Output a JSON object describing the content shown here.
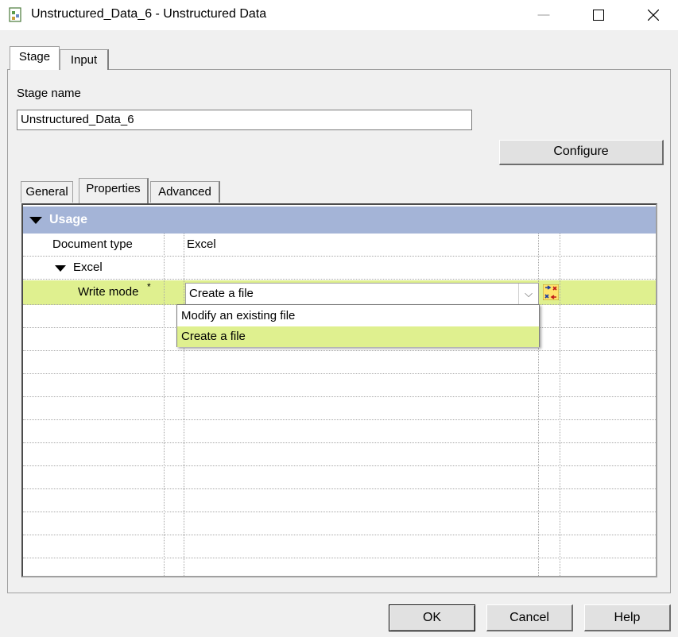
{
  "window": {
    "title": "Unstructured_Data_6 - Unstructured Data",
    "minimize_glyph": "—",
    "maximize_glyph": "☐",
    "close_glyph": "✕"
  },
  "outer_tabs": [
    {
      "label": "Stage",
      "active": true
    },
    {
      "label": "Input",
      "active": false
    }
  ],
  "stage_name": {
    "label": "Stage name",
    "value": "Unstructured_Data_6"
  },
  "configure_button": "Configure",
  "inner_tabs": [
    {
      "label": "General",
      "active": false
    },
    {
      "label": "Properties",
      "active": true
    },
    {
      "label": "Advanced",
      "active": false
    }
  ],
  "properties": {
    "section": "Usage",
    "document_type": {
      "label": "Document type",
      "value": "Excel"
    },
    "group": "Excel",
    "write_mode": {
      "label": "Write mode",
      "required_marker": "*",
      "value": "Create a file"
    },
    "dropdown_arrow": "⌵"
  },
  "dropdown_options": [
    {
      "label": "Modify an existing file",
      "selected": false
    },
    {
      "label": "Create a file",
      "selected": true
    }
  ],
  "buttons": {
    "ok": "OK",
    "cancel": "Cancel",
    "help": "Help"
  },
  "colors": {
    "section_header": "#a4b4d7",
    "highlight": "#dff08f"
  }
}
